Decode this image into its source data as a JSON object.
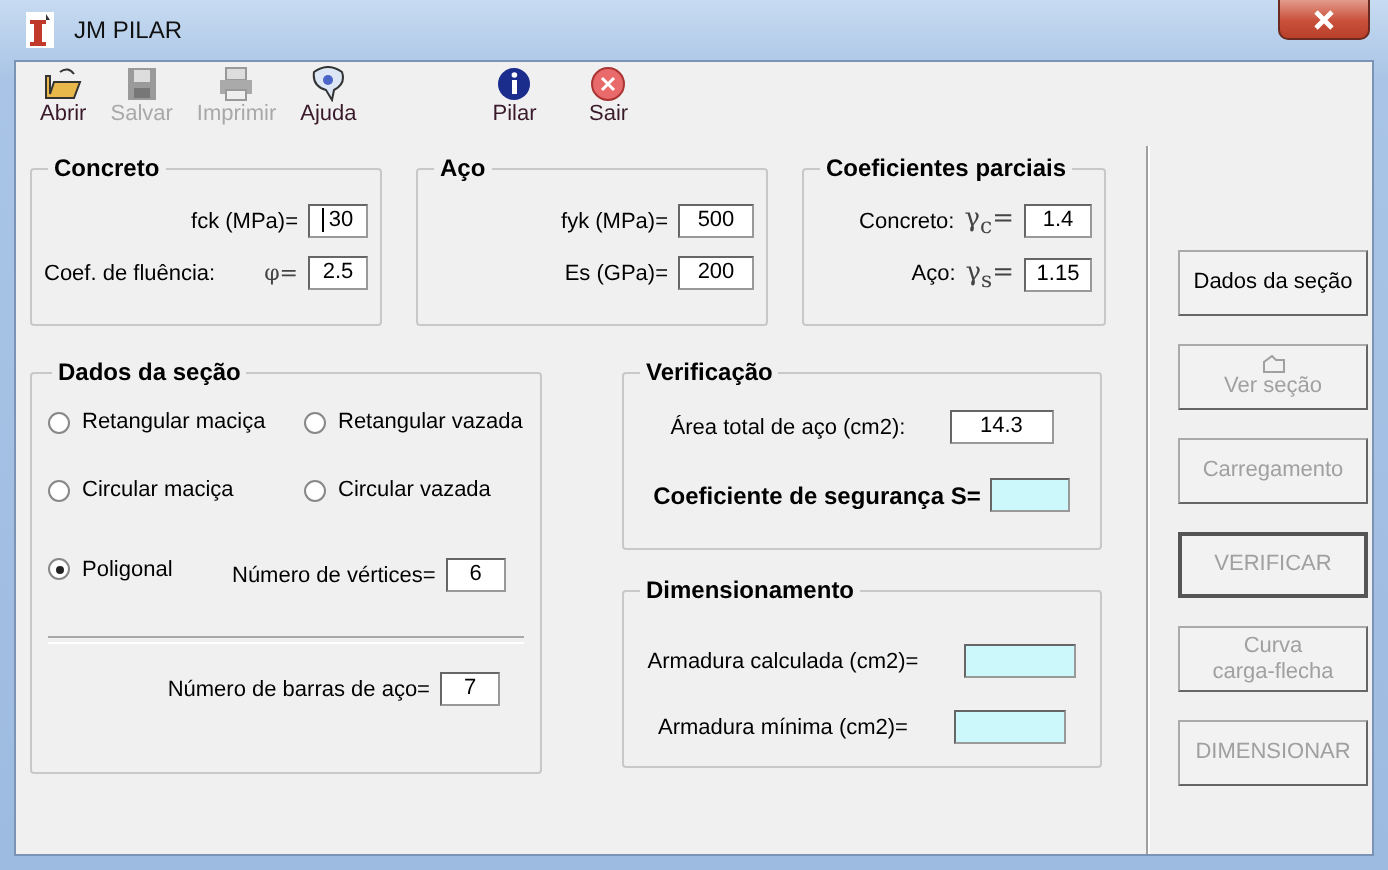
{
  "window": {
    "title": "JM PILAR"
  },
  "toolbar": {
    "left": [
      {
        "kind": "open",
        "label": "Abrir",
        "disabled": false
      },
      {
        "kind": "save",
        "label": "Salvar",
        "disabled": true
      },
      {
        "kind": "print",
        "label": "Imprimir",
        "disabled": true
      },
      {
        "kind": "help",
        "label": "Ajuda",
        "disabled": false
      }
    ],
    "right": [
      {
        "kind": "info",
        "label": "Pilar",
        "disabled": false
      },
      {
        "kind": "exit",
        "label": "Sair",
        "disabled": false
      }
    ]
  },
  "concreto": {
    "title": "Concreto",
    "fields": [
      {
        "label": "fck (MPa)=",
        "value": "30",
        "focused": true
      },
      {
        "label": "Coef. de fluência:",
        "symbol": "φ=",
        "value": "2.5",
        "focused": false
      }
    ]
  },
  "aco": {
    "title": "Aço",
    "fields": [
      {
        "label": "fyk (MPa)=",
        "value": "500"
      },
      {
        "label": "Es (GPa)=",
        "value": "200"
      }
    ]
  },
  "coeficientes": {
    "title": "Coeficientes parciais",
    "fields": [
      {
        "label": "Concreto:",
        "symbol": "γ$_{c}$=",
        "value": "1.4"
      },
      {
        "label": "Aço:",
        "symbol": "γ$_{s}$=",
        "value": "1.15"
      }
    ]
  },
  "dados_secao": {
    "title": "Dados da seção",
    "options": [
      {
        "label": "Retangular maciça",
        "selected": false
      },
      {
        "label": "Retangular vazada",
        "selected": false
      },
      {
        "label": "Circular maciça",
        "selected": false
      },
      {
        "label": "Circular vazada",
        "selected": false
      },
      {
        "label": "Poligonal",
        "selected": true
      }
    ],
    "vertices": {
      "label": "Número de vértices=",
      "value": "6"
    },
    "barras": {
      "label": "Número de barras de aço=",
      "value": "7"
    }
  },
  "verificacao": {
    "title": "Verificação",
    "fields": [
      {
        "kind": "input",
        "label": "Área total de aço (cm2):",
        "value": "14.3",
        "bold": false
      },
      {
        "kind": "result",
        "label": "Coeficiente de segurança S=",
        "bold": true
      }
    ]
  },
  "dimensionamento": {
    "title": "Dimensionamento",
    "fields": [
      {
        "kind": "result",
        "label": "Armadura calculada (cm2)="
      },
      {
        "kind": "result",
        "label": "Armadura mínima (cm2)="
      }
    ]
  },
  "actions": [
    {
      "label": "Dados da seção",
      "disabled": false,
      "default": false
    },
    {
      "label": "Ver seção",
      "disabled": true,
      "default": false,
      "icon": true
    },
    {
      "label": "Carregamento",
      "disabled": true,
      "default": false
    },
    {
      "label": "VERIFICAR",
      "disabled": true,
      "default": true
    },
    {
      "label": "Curva\ncarga-flecha",
      "disabled": true,
      "default": false
    },
    {
      "label": "DIMENSIONAR",
      "disabled": true,
      "default": false
    }
  ]
}
